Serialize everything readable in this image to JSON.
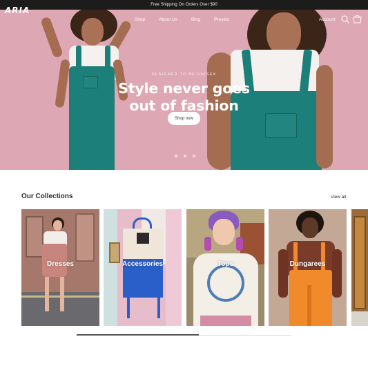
{
  "announcement": "Free Shipping On Orders Over $90",
  "brand": "ARIA",
  "nav": {
    "items": [
      "Shop",
      "About Us",
      "Blog",
      "Presets"
    ],
    "account": "Account"
  },
  "hero": {
    "eyebrow": "DESIGNED TO BE UNISEX",
    "headline_line1": "Style never goes",
    "headline_line2": "out of fashion",
    "cta": "Shop now",
    "slides": 3,
    "active_slide": 1
  },
  "collections": {
    "title": "Our Collections",
    "view_all": "View all",
    "cards": [
      {
        "label": "Dresses"
      },
      {
        "label": "Accessories"
      },
      {
        "label": "Tops"
      },
      {
        "label": "Dungarees"
      }
    ]
  },
  "colors": {
    "hero_bg": "#dea7b4",
    "announcement_bg": "#1c1c1c",
    "overall_teal": "#1d7f79"
  },
  "icons": [
    "search-icon",
    "cart-icon"
  ]
}
